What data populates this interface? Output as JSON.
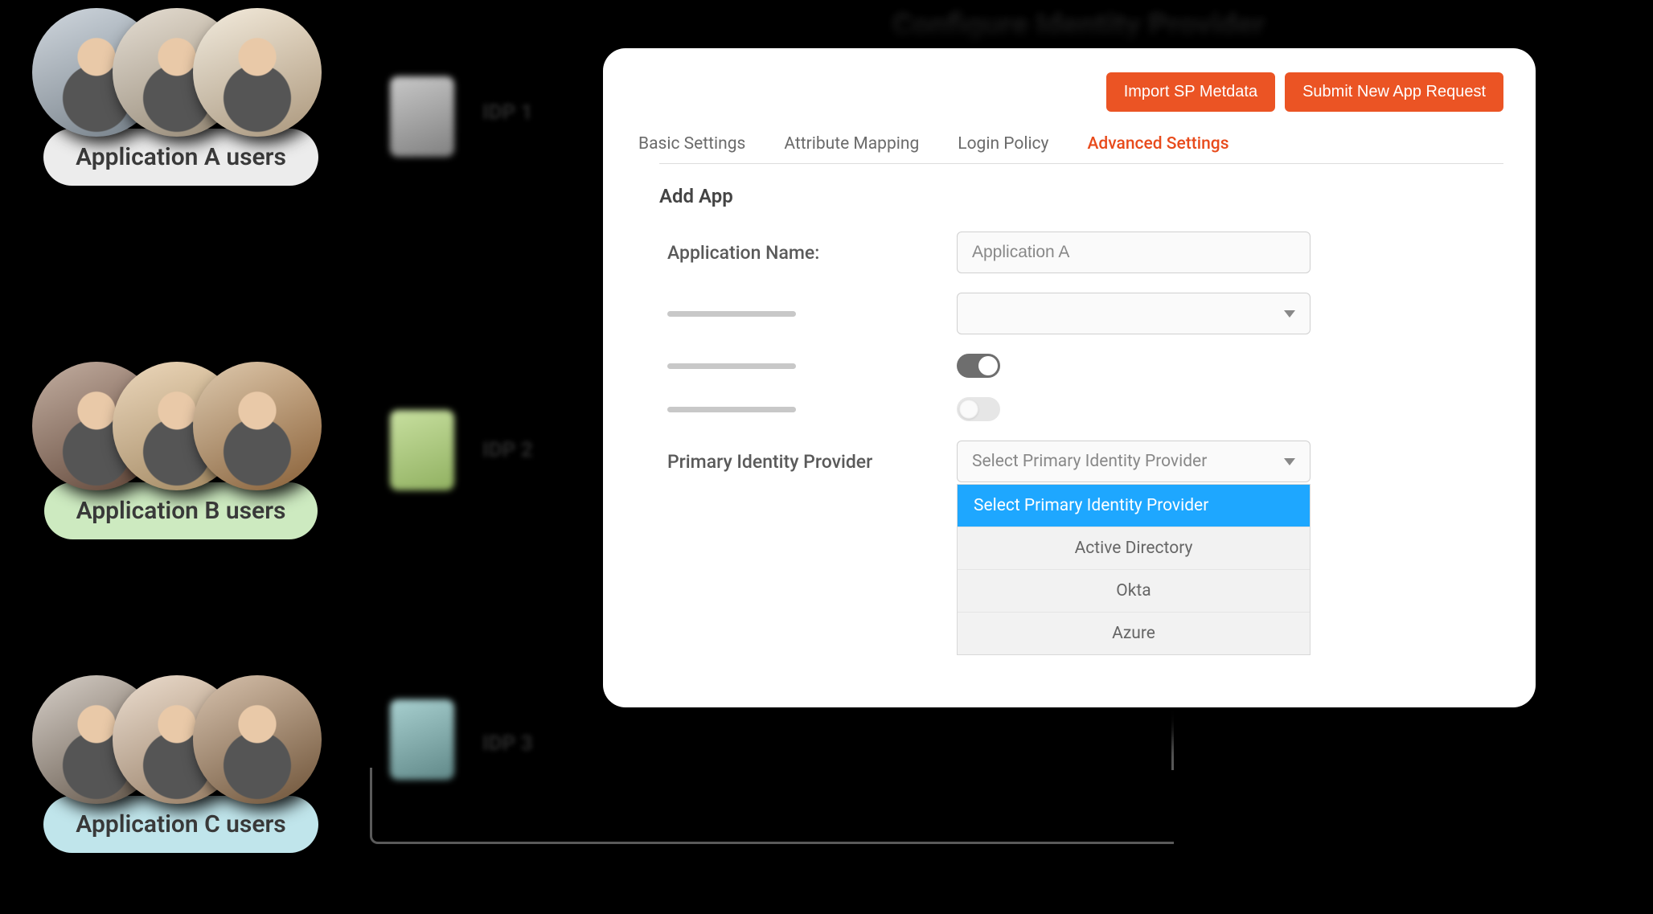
{
  "header_blur": "Configure Identity Provider",
  "groups": {
    "a": {
      "label": "Application A users",
      "idp_short": "IDP 1"
    },
    "b": {
      "label": "Application B users",
      "idp_short": "IDP 2"
    },
    "c": {
      "label": "Application C users",
      "idp_short": "IDP 3"
    }
  },
  "panel": {
    "buttons": {
      "import": "Import SP Metdata",
      "submit": "Submit New App Request"
    },
    "tabs": {
      "basic": "Basic Settings",
      "attribute": "Attribute Mapping",
      "login": "Login Policy",
      "advanced": "Advanced Settings"
    },
    "section_title": "Add App",
    "form": {
      "app_name_label": "Application Name:",
      "app_name_value": "Application A",
      "primary_idp_label": "Primary Identity Provider",
      "primary_idp_placeholder": "Select Primary Identity Provider",
      "dropdown": {
        "0": "Select Primary Identity Provider",
        "1": "Active Directory",
        "2": "Okta",
        "3": "Azure"
      }
    }
  }
}
